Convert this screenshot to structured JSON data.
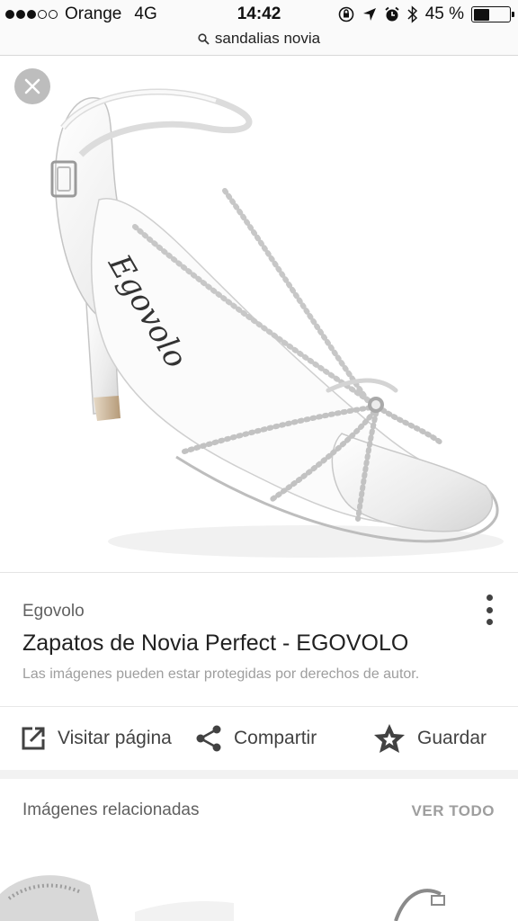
{
  "status_bar": {
    "carrier": "Orange",
    "network": "4G",
    "time": "14:42",
    "battery": "45 %",
    "battery_level": 0.45,
    "signal_bars_filled": 3,
    "signal_bars_total": 5,
    "icons": [
      "orientation-lock-icon",
      "location-icon",
      "alarm-icon",
      "bluetooth-icon",
      "battery-icon"
    ]
  },
  "url_bar": {
    "query": "sandalias novia",
    "icon": "search-icon"
  },
  "viewer": {
    "image_alt": "Zapatos de Novia Perfect - EGOVOLO",
    "insole_logo": "Egovolo",
    "close_icon": "close-icon"
  },
  "info": {
    "source": "Egovolo",
    "title": "Zapatos de Novia Perfect - EGOVOLO",
    "copyright_note": "Las imágenes pueden estar protegidas por derechos de autor.",
    "more_icon": "more-vert-icon",
    "actions": [
      {
        "label": "Visitar página",
        "icon": "open-in-new-icon"
      },
      {
        "label": "Compartir",
        "icon": "share-icon"
      },
      {
        "label": "Guardar",
        "icon": "star-icon"
      }
    ]
  },
  "related": {
    "title": "Imágenes relacionadas",
    "see_all": "VER TODO"
  },
  "colors": {
    "bar_background": "#fafafa",
    "text_primary": "#212121",
    "text_secondary": "#616161",
    "text_hint": "#9e9e9e",
    "close_button": "#bdbdbd"
  }
}
